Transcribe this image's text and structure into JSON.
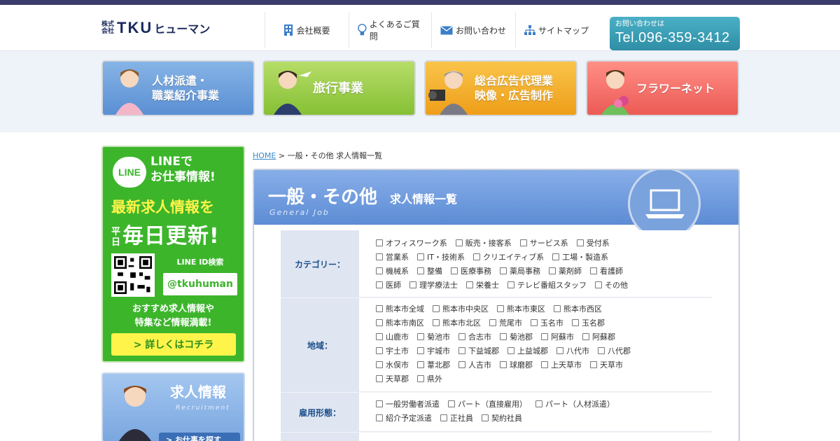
{
  "header": {
    "logo_kabu1": "株式",
    "logo_kabu2": "会社",
    "logo_name": "TKU",
    "logo_name2": "ヒューマン",
    "nav": [
      "会社概要",
      "よくあるご質問",
      "お問い合わせ",
      "サイトマップ"
    ],
    "tel_label": "お問い合わせは",
    "tel_number": "Tel.096-359-3412"
  },
  "banners": [
    {
      "line1": "人材派遣・",
      "line2": "職業紹介事業"
    },
    {
      "line1": "旅行事業",
      "line2": ""
    },
    {
      "line1": "総合広告代理業",
      "line2": "映像・広告制作"
    },
    {
      "line1": "フラワーネット",
      "line2": ""
    }
  ],
  "line_box": {
    "logo": "LINE",
    "title1": "LINEで",
    "title2": "お仕事情報!",
    "headline": "最新求人情報を",
    "heijitsu": "平日",
    "daily": "毎日更新!",
    "id_label": "LINE ID検索",
    "id": "@tkuhuman",
    "desc1": "おすすめ求人情報や",
    "desc2": "特集など情報満載!",
    "button": "> 詳しくはコチラ"
  },
  "recruit_box": {
    "title": "求人情報",
    "sub": "Recruitment",
    "button": "> お仕事を探す"
  },
  "breadcrumb": {
    "home": "HOME",
    "sep": " > ",
    "current": "一般・その他 求人情報一覧"
  },
  "main": {
    "title": "一般・その他",
    "title2": "求人情報一覧",
    "subtitle": "General Job"
  },
  "filters": {
    "category_label": "カテゴリー：",
    "category_rows": [
      [
        "オフィスワーク系",
        "販売・接客系",
        "サービス系",
        "受付系"
      ],
      [
        "営業系",
        "IT・技術系",
        "クリエイティブ系",
        "工場・製造系"
      ],
      [
        "機械系",
        "整備",
        "医療事務",
        "薬局事務",
        "薬剤師",
        "看護師"
      ],
      [
        "医師",
        "理学療法士",
        "栄養士",
        "テレビ番組スタッフ",
        "その他"
      ]
    ],
    "area_label": "地域：",
    "area_rows": [
      [
        "熊本市全域",
        "熊本市中央区",
        "熊本市東区",
        "熊本市西区"
      ],
      [
        "熊本市南区",
        "熊本市北区",
        "荒尾市",
        "玉名市",
        "玉名郡"
      ],
      [
        "山鹿市",
        "菊池市",
        "合志市",
        "菊池郡",
        "阿蘇市",
        "阿蘇郡"
      ],
      [
        "宇土市",
        "宇城市",
        "下益城郡",
        "上益城郡",
        "八代市",
        "八代郡"
      ],
      [
        "水俣市",
        "葦北郡",
        "人吉市",
        "球磨郡",
        "上天草市",
        "天草市"
      ],
      [
        "天草郡",
        "県外"
      ]
    ],
    "employment_label": "雇用形態：",
    "employment_rows": [
      [
        "一般労働者派遣",
        "パート（直接雇用）",
        "パート（人材派遣）"
      ],
      [
        "紹介予定派遣",
        "正社員",
        "契約社員"
      ]
    ]
  }
}
